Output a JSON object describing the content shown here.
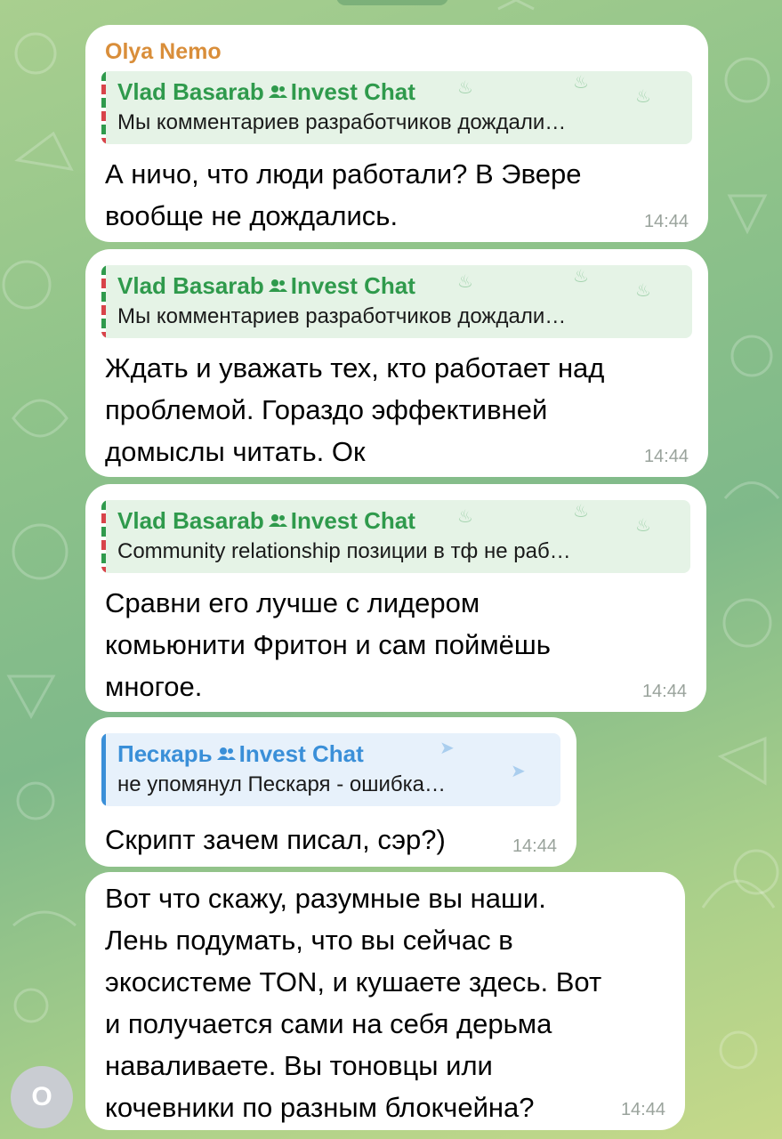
{
  "colors": {
    "sender": "#d98e3a",
    "reply_green": "#2f9a4c",
    "reply_blue": "#3a8fd8",
    "timestamp": "#9aa39c"
  },
  "messages": [
    {
      "sender": "Olya Nemo",
      "reply": {
        "name": "Vlad Basarab",
        "group_icon": "group-icon",
        "chat": "Invest Chat",
        "text": "Мы комментариев разработчиков дождали…"
      },
      "lines": [
        "А ничо, что люди работали? В Эвере",
        "вообще не дождались."
      ],
      "time": "14:44"
    },
    {
      "reply": {
        "name": "Vlad Basarab",
        "group_icon": "group-icon",
        "chat": "Invest Chat",
        "text": "Мы комментариев разработчиков дождали…"
      },
      "lines": [
        "Ждать и уважать тех, кто работает над",
        "проблемой. Гораздо эффективней",
        "домыслы читать. Ок"
      ],
      "time": "14:44"
    },
    {
      "reply": {
        "name": "Vlad Basarab",
        "group_icon": "group-icon",
        "chat": "Invest Chat",
        "text": "Community relationship позиции в тф не раб…"
      },
      "lines": [
        "Сравни его лучше с лидером",
        "комьюнити  Фритон и сам поймёшь",
        "многое."
      ],
      "time": "14:44"
    },
    {
      "reply": {
        "name": "Пескарь",
        "group_icon": "group-icon",
        "chat": "Invest Chat",
        "text": "не упомянул Пескаря - ошибка…"
      },
      "lines": [
        "Скрипт зачем писал, сэр?)"
      ],
      "time": "14:44"
    },
    {
      "lines": [
        "Вот что скажу, разумные вы наши.",
        "Лень подумать, что вы сейчас  в",
        "экосистеме TON, и кушаете здесь. Вот",
        "и получается сами на себя дерьма",
        "наваливаете.  Вы тоновцы или",
        "кочевники по разным блокчейна?"
      ],
      "time": "14:44"
    }
  ],
  "avatar": {
    "initial": "O"
  }
}
